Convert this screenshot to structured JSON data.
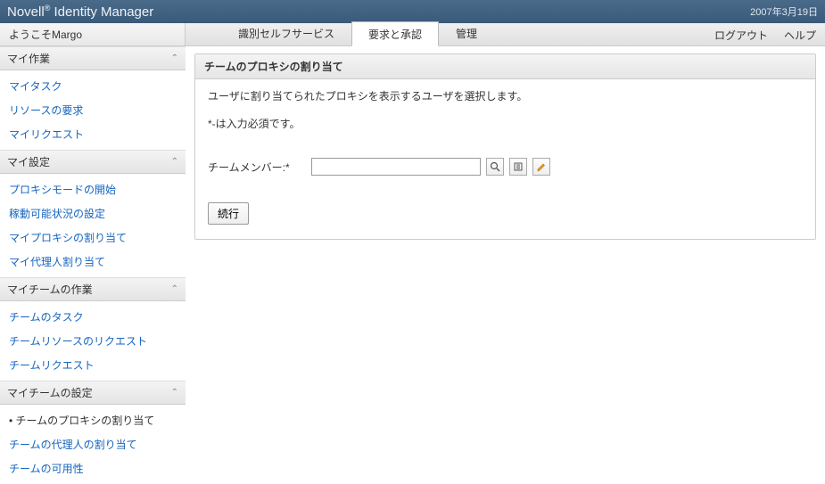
{
  "header": {
    "product_prefix": "Novell",
    "product_name": " Identity Manager",
    "date": "2007年3月19日"
  },
  "welcome": {
    "prefix": "ようこそ",
    "user": "Margo"
  },
  "tabs": {
    "selfservice": "識別セルフサービス",
    "requests": "要求と承認",
    "admin": "管理"
  },
  "top_links": {
    "logout": "ログアウト",
    "help": "ヘルプ"
  },
  "sidebar": {
    "groups": {
      "mywork": {
        "title": "マイ作業",
        "items": {
          "mytasks": "マイタスク",
          "resource_req": "リソースの要求",
          "myrequests": "マイリクエスト"
        }
      },
      "mysettings": {
        "title": "マイ設定",
        "items": {
          "proxy_start": "プロキシモードの開始",
          "avail": "稼動可能状況の設定",
          "myproxy": "マイプロキシの割り当て",
          "mydelegate": "マイ代理人割り当て"
        }
      },
      "teamwork": {
        "title": "マイチームの作業",
        "items": {
          "team_tasks": "チームのタスク",
          "team_res_req": "チームリソースのリクエスト",
          "team_req": "チームリクエスト"
        }
      },
      "teamsettings": {
        "title": "マイチームの設定",
        "items": {
          "team_proxy": "チームのプロキシの割り当て",
          "team_delegate": "チームの代理人の割り当て",
          "team_avail": "チームの可用性"
        }
      }
    }
  },
  "panel": {
    "title": "チームのプロキシの割り当て",
    "instruction": "ユーザに割り当てられたプロキシを表示するユーザを選択します。",
    "required_note": "*-は入力必須です。",
    "field_label": "チームメンバー:*",
    "continue_btn": "続行"
  },
  "icons": {
    "search": "search-icon",
    "history": "history-icon",
    "edit": "edit-icon"
  }
}
